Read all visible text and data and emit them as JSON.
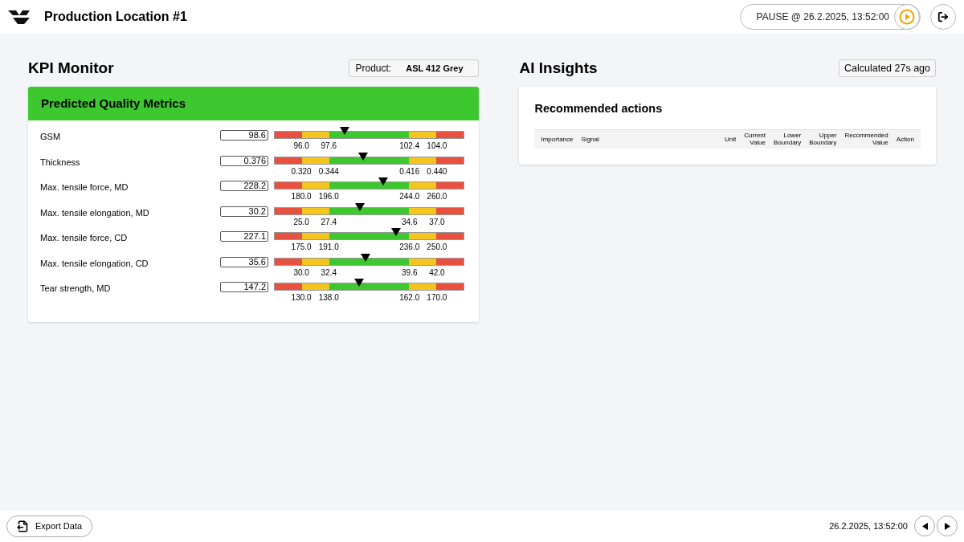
{
  "header": {
    "title": "Production Location #1",
    "status": "PAUSE @ 26.2.2025, 13:52:00"
  },
  "kpi": {
    "title": "KPI Monitor",
    "product_label": "Product:",
    "product_value": "ASL 412 Grey",
    "card_title": "Predicted Quality Metrics",
    "metrics": [
      {
        "name": "GSM",
        "value": "98.6",
        "level": 0.373,
        "ticks": [
          "96.0",
          "97.6",
          "102.4",
          "104.0"
        ]
      },
      {
        "name": "Thickness",
        "value": "0.376",
        "level": 0.47,
        "ticks": [
          "0.320",
          "0.344",
          "0.416",
          "0.440"
        ]
      },
      {
        "name": "Max. tensile force, MD",
        "value": "228.2",
        "level": 0.572,
        "ticks": [
          "180.0",
          "196.0",
          "244.0",
          "260.0"
        ]
      },
      {
        "name": "Max. tensile elongation, MD",
        "value": "30.2",
        "level": 0.453,
        "ticks": [
          "25.0",
          "27.4",
          "34.6",
          "37.0"
        ]
      },
      {
        "name": "Max. tensile force, CD",
        "value": "227.1",
        "level": 0.64,
        "ticks": [
          "175.0",
          "191.0",
          "236.0",
          "250.0"
        ]
      },
      {
        "name": "Max. tensile elongation, CD",
        "value": "35.6",
        "level": 0.479,
        "ticks": [
          "30.0",
          "32.4",
          "39.6",
          "42.0"
        ]
      },
      {
        "name": "Tear strength, MD",
        "value": "147.2",
        "level": 0.449,
        "ticks": [
          "130.0",
          "138.0",
          "162.0",
          "170.0"
        ]
      }
    ]
  },
  "ai": {
    "title": "AI Insights",
    "calculated": "Calculated 27s ago",
    "card_title": "Recommended actions",
    "columns": [
      "Importance",
      "Signal",
      "Unit",
      "Current Value",
      "Lower Boundary",
      "Upper Boundary",
      "Recommended Value",
      "Action"
    ]
  },
  "footer": {
    "export": "Export Data",
    "timestamp": "26.2.2025, 13:52:00"
  }
}
